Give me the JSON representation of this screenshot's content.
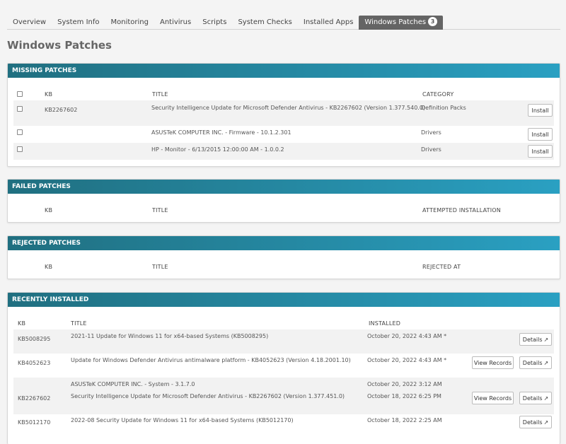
{
  "tabs": [
    {
      "label": "Overview"
    },
    {
      "label": "System Info"
    },
    {
      "label": "Monitoring"
    },
    {
      "label": "Antivirus"
    },
    {
      "label": "Scripts"
    },
    {
      "label": "System Checks"
    },
    {
      "label": "Installed Apps"
    },
    {
      "label": "Windows Patches",
      "badge": "3",
      "active": true
    }
  ],
  "page_title": "Windows Patches",
  "missing": {
    "header": "MISSING PATCHES",
    "columns": {
      "kb": "KB",
      "title": "TITLE",
      "category": "CATEGORY"
    },
    "install_label": "Install",
    "rows": [
      {
        "kb": "KB2267602",
        "title": "Security Intelligence Update for Microsoft Defender Antivirus - KB2267602 (Version 1.377.540.0)",
        "category": "Definition Packs"
      },
      {
        "kb": "",
        "title": "ASUSTeK COMPUTER INC. - Firmware - 10.1.2.301",
        "category": "Drivers"
      },
      {
        "kb": "",
        "title": "HP - Monitor - 6/13/2015 12:00:00 AM - 1.0.0.2",
        "category": "Drivers"
      }
    ]
  },
  "failed": {
    "header": "FAILED PATCHES",
    "columns": {
      "kb": "KB",
      "title": "TITLE",
      "attempted": "ATTEMPTED INSTALLATION"
    }
  },
  "rejected": {
    "header": "REJECTED PATCHES",
    "columns": {
      "kb": "KB",
      "title": "TITLE",
      "rejected_at": "REJECTED AT"
    }
  },
  "installed": {
    "header": "RECENTLY INSTALLED",
    "columns": {
      "kb": "KB",
      "title": "TITLE",
      "installed": "INSTALLED"
    },
    "details_label": "Details",
    "view_records_label": "View Records",
    "rows": [
      {
        "kb": "KB5008295",
        "title": "2021-11 Update for Windows 11 for x64-based Systems (KB5008295)",
        "installed": "October 20, 2022 4:43 AM *"
      },
      {
        "kb": "KB4052623",
        "title": "Update for Windows Defender Antivirus antimalware platform - KB4052623 (Version 4.18.2001.10)",
        "installed": "October 20, 2022 4:43 AM *"
      },
      {
        "kb": "",
        "title": "ASUSTeK COMPUTER INC. - System - 3.1.7.0",
        "installed": "October 20, 2022 3:12 AM"
      },
      {
        "kb": "KB2267602",
        "title": "Security Intelligence Update for Microsoft Defender Antivirus - KB2267602 (Version 1.377.451.0)",
        "installed": "October 18, 2022 6:25 PM"
      },
      {
        "kb": "KB5012170",
        "title": "2022-08 Security Update for Windows 11 for x64-based Systems (KB5012170)",
        "installed": "October 18, 2022 2:25 AM"
      }
    ]
  },
  "colors": {
    "header_gradient_start": "#206f80",
    "header_gradient_end": "#2aa0c2",
    "active_tab": "#646464"
  }
}
